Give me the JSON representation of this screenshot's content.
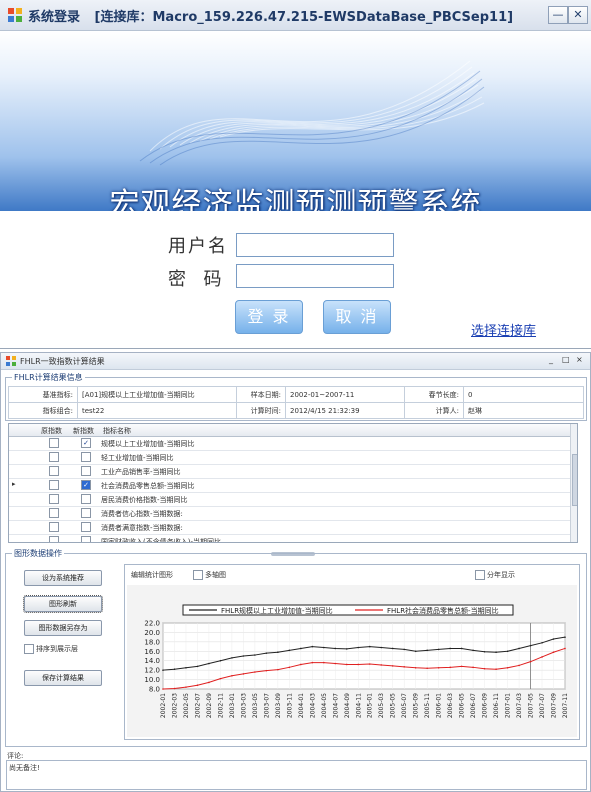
{
  "login_window": {
    "title": "系统登录",
    "connection": "[连接库：Macro_159.226.47.215-EWSDataBase_PBCSep11]",
    "banner_title": "宏观经济监测预测预警系统",
    "username_label": "用户名",
    "password_label": "密  码",
    "username_value": "",
    "password_value": "",
    "login_button": "登 录",
    "cancel_button": "取 消",
    "select_connection_link": "选择连接库",
    "min_glyph": "—",
    "close_glyph": "✕"
  },
  "fhlr_window": {
    "title": "FHLR一致指数计算结果",
    "controls": {
      "min": "_",
      "max": "□",
      "close": "×"
    },
    "info_group_title": "FHLR计算结果信息",
    "info": {
      "base_indicator_label": "基准指标:",
      "base_indicator_value": "[A01]规模以上工业增加值-当期同比",
      "sample_date_label": "样本日期:",
      "sample_date_value": "2002-01~2007-11",
      "season_length_label": "春节长度:",
      "season_length_value": "0",
      "indicator_group_label": "指标组合:",
      "indicator_group_value": "test22",
      "calc_time_label": "计算时间:",
      "calc_time_value": "2012/4/15 21:32:39",
      "calculator_label": "计算人:",
      "calculator_value": "赵琳"
    },
    "grid": {
      "headers": [
        "原指数",
        "新指数",
        "指标名称"
      ],
      "current_marker": "▸",
      "rows": [
        {
          "orig": false,
          "new": true,
          "name": "规模以上工业增加值-当期同比"
        },
        {
          "orig": false,
          "new": false,
          "name": "轻工业增加值-当期同比"
        },
        {
          "orig": false,
          "new": false,
          "name": "工业产品销售率-当期同比"
        },
        {
          "orig": false,
          "new": true,
          "name": "社会消费品零售总额-当期同比"
        },
        {
          "orig": false,
          "new": false,
          "name": "居民消费价格指数-当期同比"
        },
        {
          "orig": false,
          "new": false,
          "name": "消费者信心指数-当期数据:"
        },
        {
          "orig": false,
          "new": false,
          "name": "消费者满意指数-当期数据:"
        },
        {
          "orig": false,
          "new": false,
          "name": "国家财政收入(不含债务收入)-当期同比"
        }
      ]
    },
    "ops_group_title": "图形数据操作",
    "buttons": {
      "set_default": "设为系统推荐",
      "refresh_chart": "图形刷新",
      "save_chart_data": "图形数据另存为",
      "save_results": "保存计算结果"
    },
    "checkboxes": {
      "sort_display": "排序到展示层",
      "edit_chart": "多轴图",
      "split_years": "分年显示"
    },
    "chart_panel_caption": "编辑统计图形",
    "comment_label": "评论:",
    "comment_value": "尚无备注!"
  },
  "chart_data": {
    "type": "line",
    "title": "",
    "xlabel": "",
    "ylabel": "",
    "ylim": [
      8.0,
      22.0
    ],
    "yticks": [
      8.0,
      10.0,
      12.0,
      14.0,
      16.0,
      18.0,
      20.0,
      22.0
    ],
    "legend_position": "top",
    "grid": true,
    "x": [
      "2002-01",
      "2002-03",
      "2002-05",
      "2002-07",
      "2002-09",
      "2002-11",
      "2003-01",
      "2003-03",
      "2003-05",
      "2003-07",
      "2003-09",
      "2003-11",
      "2004-01",
      "2004-03",
      "2004-05",
      "2004-07",
      "2004-09",
      "2004-11",
      "2005-01",
      "2005-03",
      "2005-05",
      "2005-07",
      "2005-09",
      "2005-11",
      "2006-01",
      "2006-03",
      "2006-05",
      "2006-07",
      "2006-09",
      "2006-11",
      "2007-01",
      "2007-03",
      "2007-05",
      "2007-07",
      "2007-09",
      "2007-11"
    ],
    "series": [
      {
        "name": "FHLR规模以上工业增加值-当期同比",
        "color": "#222222",
        "values": [
          12.0,
          12.2,
          12.5,
          12.8,
          13.4,
          14.0,
          14.6,
          15.0,
          15.2,
          15.6,
          15.8,
          16.2,
          16.6,
          17.0,
          16.8,
          16.6,
          16.5,
          16.8,
          17.0,
          16.8,
          16.6,
          16.4,
          16.0,
          16.2,
          16.4,
          16.6,
          16.6,
          16.2,
          15.9,
          15.8,
          16.0,
          16.6,
          17.2,
          17.8,
          18.6,
          19.0
        ]
      },
      {
        "name": "FHLR社会消费品零售总额-当期同比",
        "color": "#e02020",
        "values": [
          8.0,
          8.1,
          8.4,
          8.8,
          9.4,
          10.2,
          10.8,
          11.2,
          11.6,
          11.9,
          12.1,
          12.6,
          13.2,
          13.6,
          13.6,
          13.4,
          13.2,
          13.2,
          13.3,
          13.1,
          12.9,
          12.7,
          12.5,
          12.4,
          12.5,
          12.6,
          12.8,
          12.6,
          12.3,
          12.2,
          12.5,
          13.0,
          13.8,
          14.8,
          15.8,
          16.6
        ]
      }
    ]
  }
}
